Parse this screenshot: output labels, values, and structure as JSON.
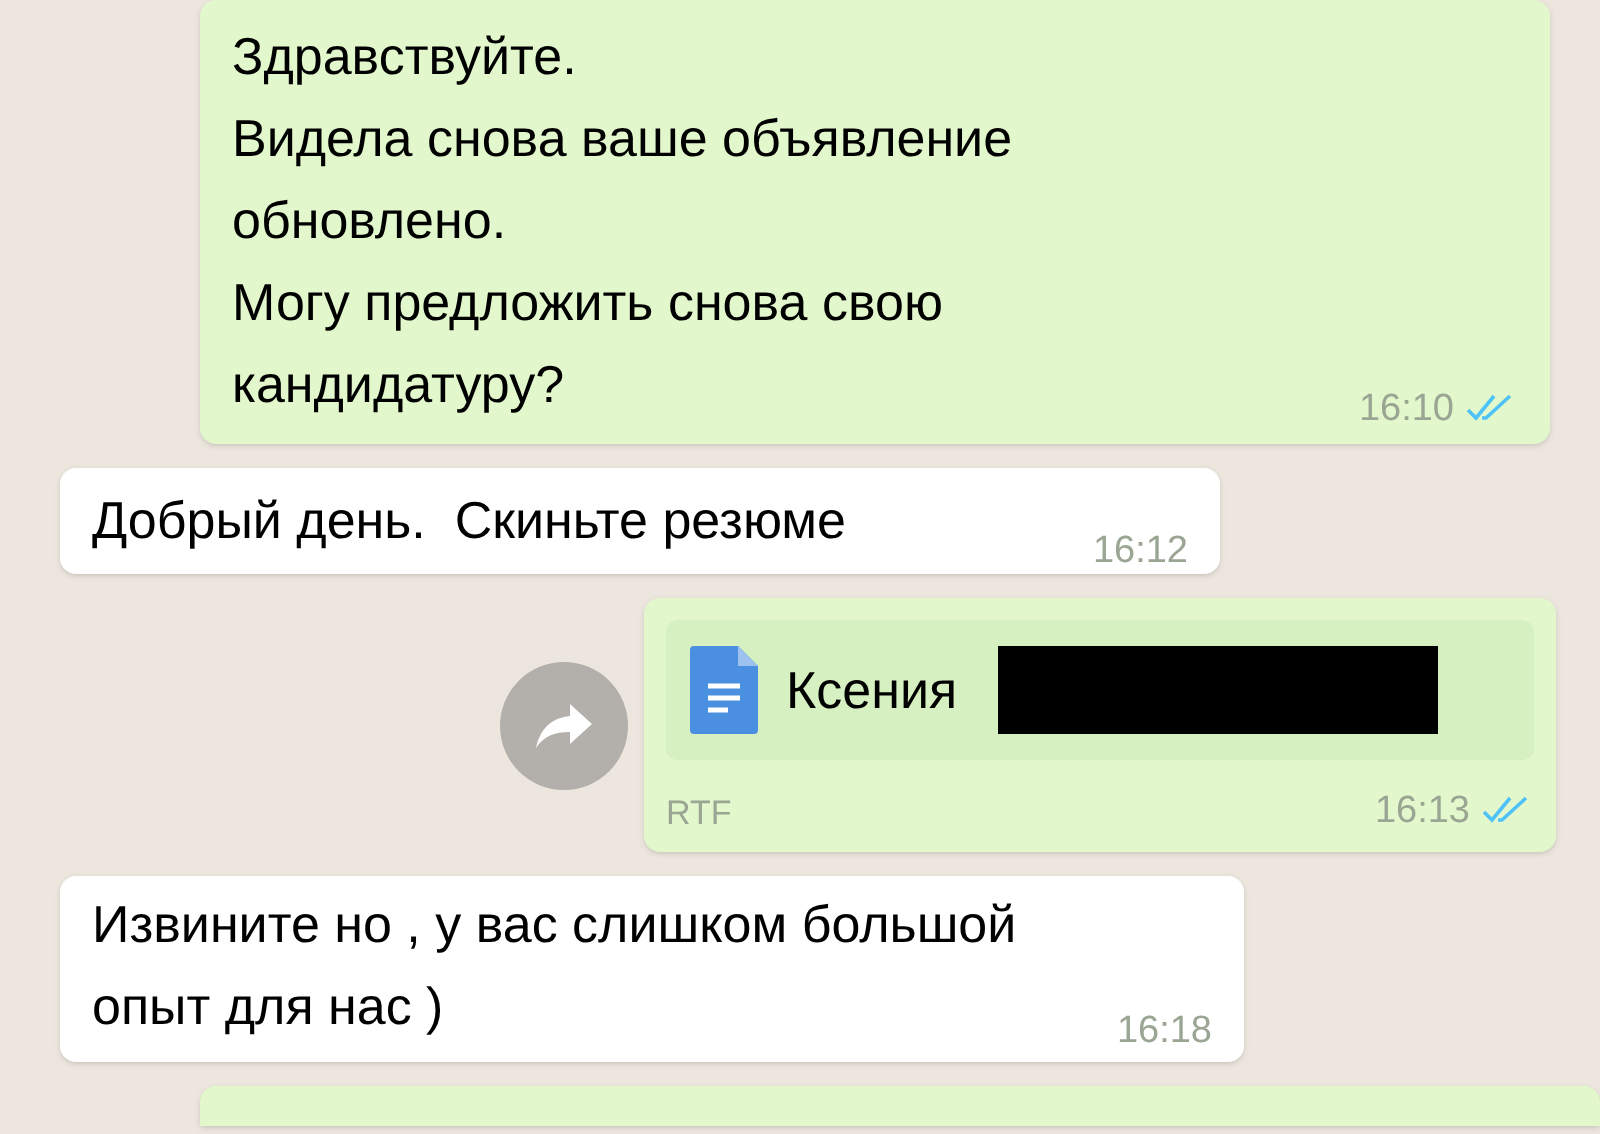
{
  "messages": [
    {
      "outgoing": true,
      "kind": "text",
      "lines": [
        "Здравствуйте.",
        "Видела снова ваше объявление",
        "обновлено.",
        "Могу предложить снова свою",
        "кандидатуру?"
      ],
      "time": "16:10",
      "read": true
    },
    {
      "outgoing": false,
      "kind": "text",
      "lines": [
        "Добрый день.  Скиньте резюме"
      ],
      "time": "16:12"
    },
    {
      "outgoing": true,
      "kind": "document",
      "file_name": "Ксения",
      "redacted": true,
      "file_type": "RTF",
      "time": "16:13",
      "read": true,
      "forward": true
    },
    {
      "outgoing": false,
      "kind": "text",
      "lines": [
        "Извините но , у вас слишком большой",
        "опыт для нас )"
      ],
      "time": "16:18"
    },
    {
      "outgoing": true,
      "kind": "partial"
    }
  ]
}
